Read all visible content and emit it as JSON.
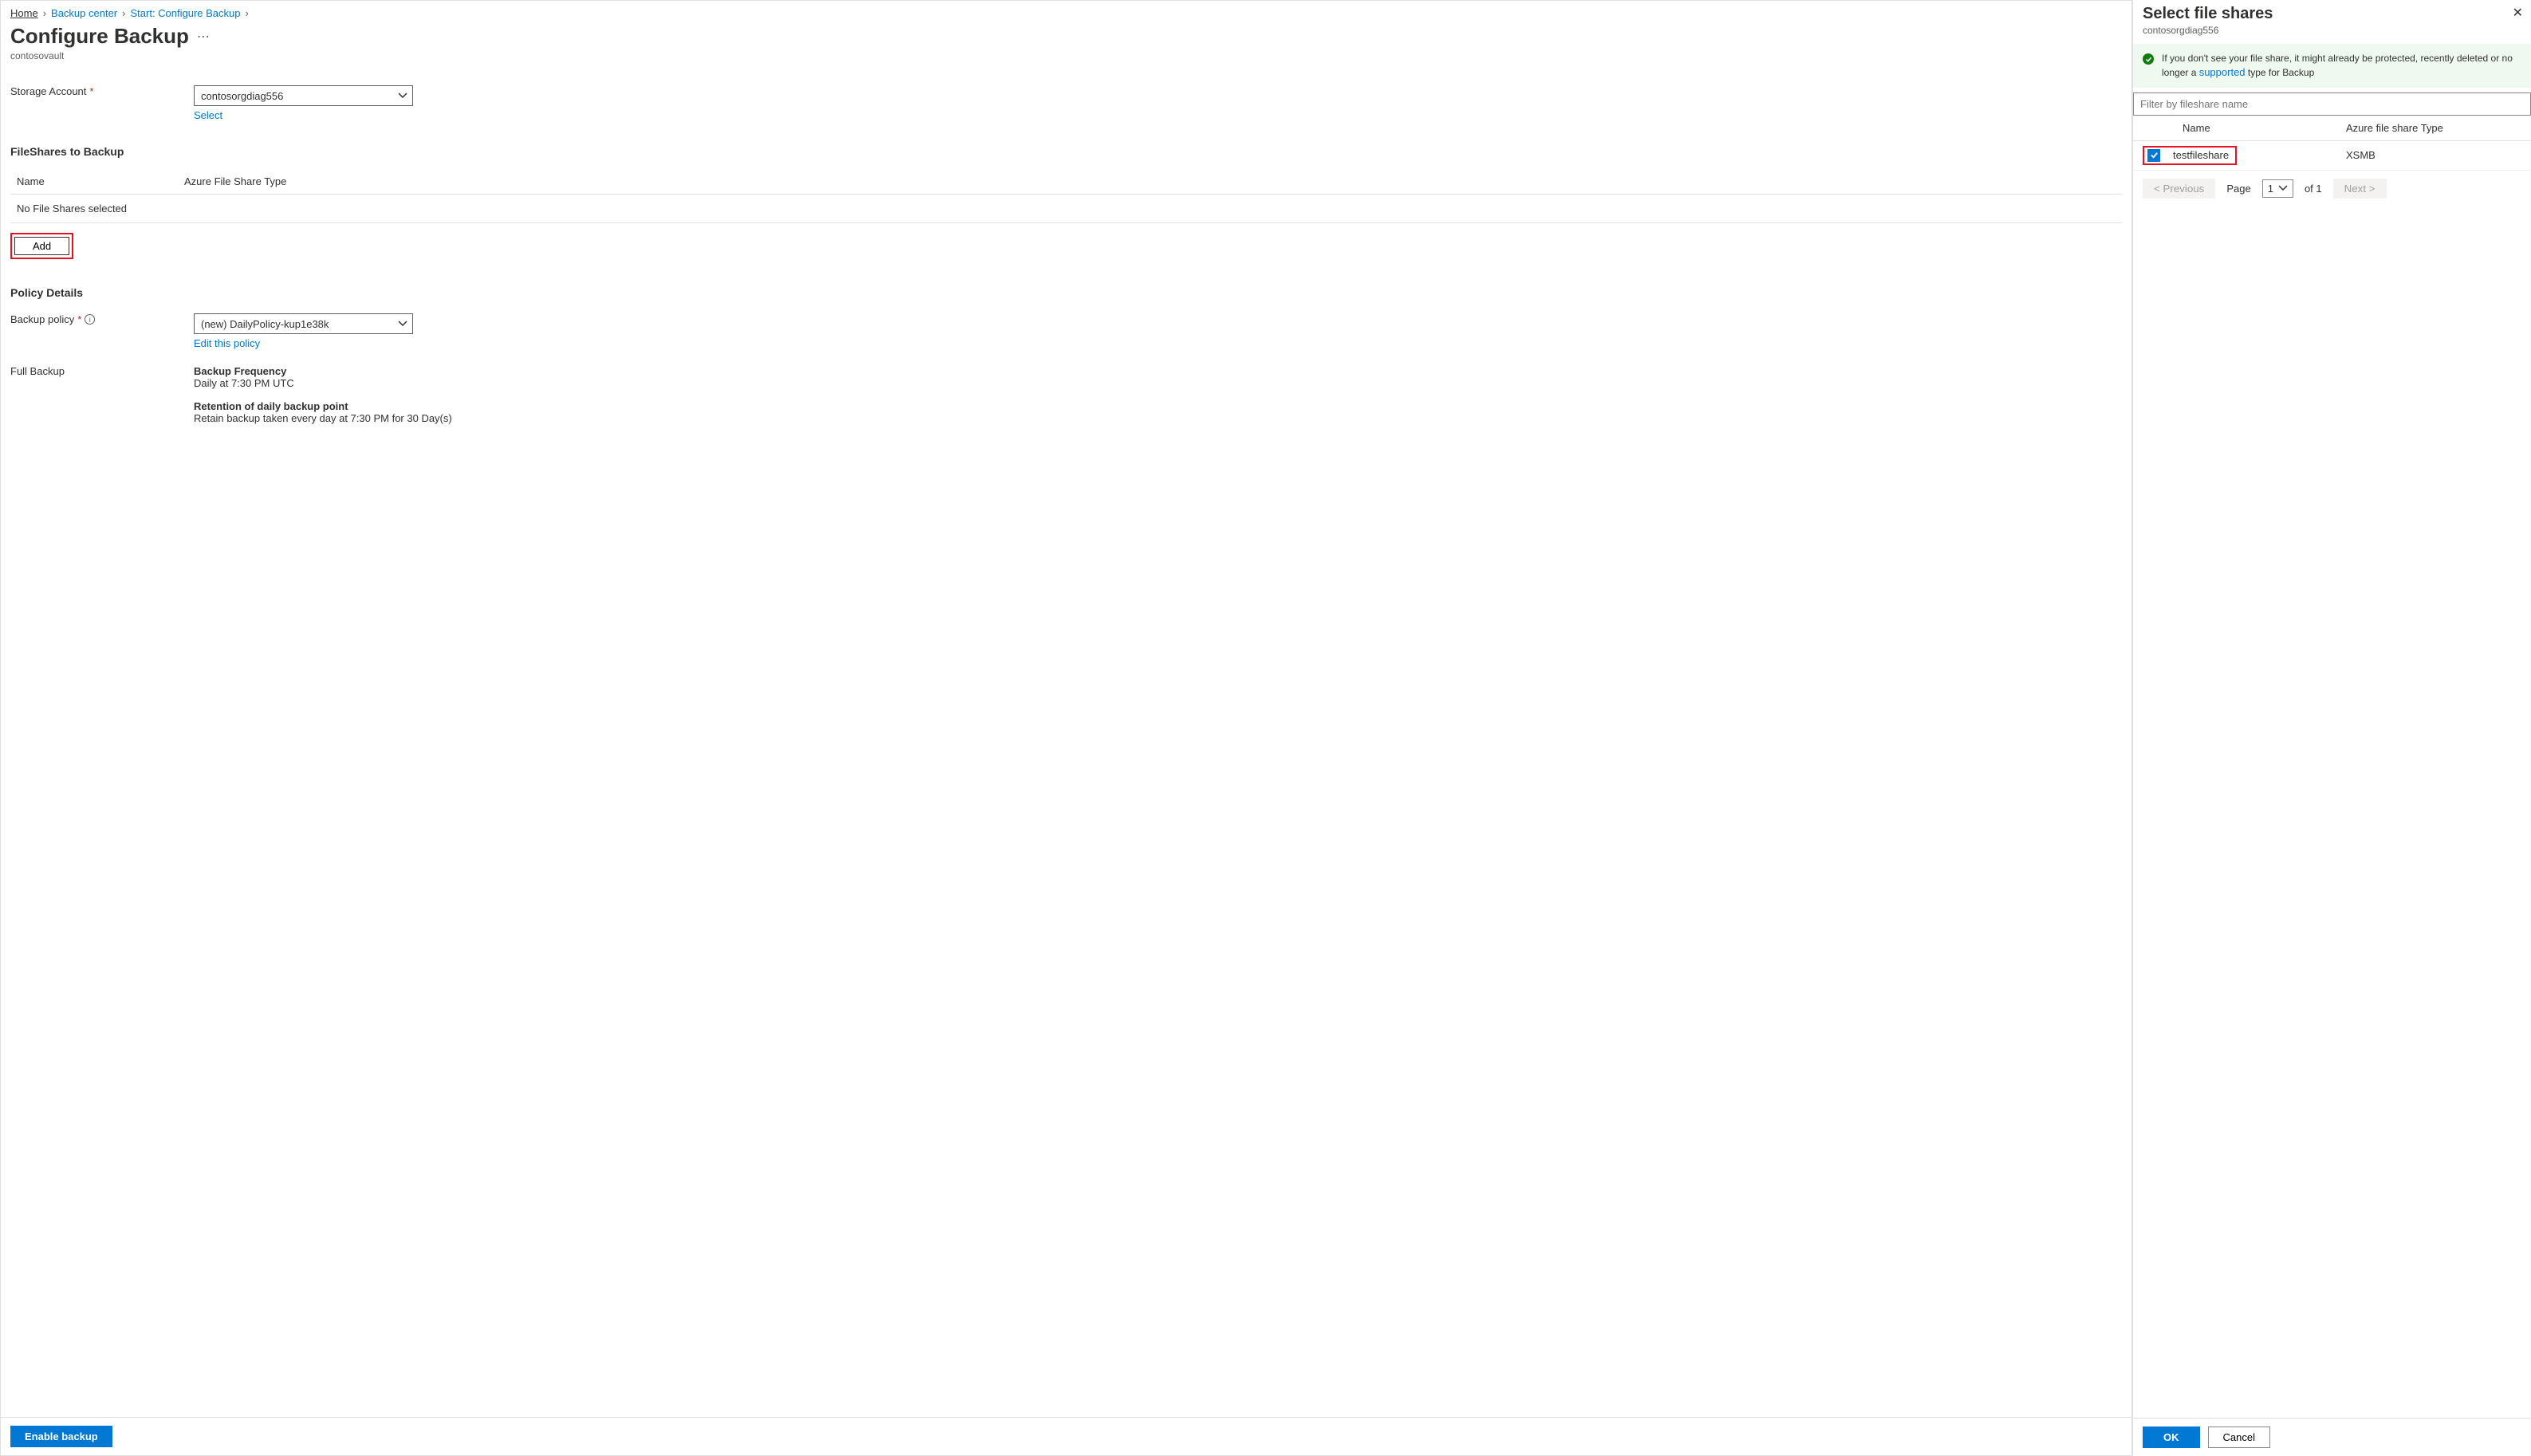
{
  "breadcrumb": {
    "home": "Home",
    "backup_center": "Backup center",
    "start": "Start: Configure Backup"
  },
  "page": {
    "title": "Configure Backup",
    "subtitle": "contosovault"
  },
  "storage": {
    "label": "Storage Account",
    "value": "contosorgdiag556",
    "select_link": "Select"
  },
  "fileshares": {
    "heading": "FileShares to Backup",
    "col_name": "Name",
    "col_type": "Azure File Share Type",
    "empty": "No File Shares selected",
    "add_label": "Add"
  },
  "policy": {
    "heading": "Policy Details",
    "label": "Backup policy",
    "value": "(new) DailyPolicy-kup1e38k",
    "edit_link": "Edit this policy",
    "full_backup_label": "Full Backup",
    "freq_title": "Backup Frequency",
    "freq_value": "Daily at 7:30 PM UTC",
    "retention_title": "Retention of daily backup point",
    "retention_value": "Retain backup taken every day at 7:30 PM for 30 Day(s)"
  },
  "footer": {
    "enable": "Enable backup"
  },
  "panel": {
    "title": "Select file shares",
    "subtitle": "contosorgdiag556",
    "banner_pre": "If you don't see your file share, it might already be protected, recently deleted or no longer a ",
    "banner_link": "supported",
    "banner_post": " type for Backup",
    "filter_placeholder": "Filter by fileshare name",
    "col_name": "Name",
    "col_type": "Azure file share Type",
    "rows": [
      {
        "name": "testfileshare",
        "type": "XSMB",
        "checked": true
      }
    ],
    "prev": "<  Previous",
    "page_label": "Page",
    "page_value": "1",
    "of_label": "of 1",
    "next": "Next  >",
    "ok": "OK",
    "cancel": "Cancel"
  }
}
